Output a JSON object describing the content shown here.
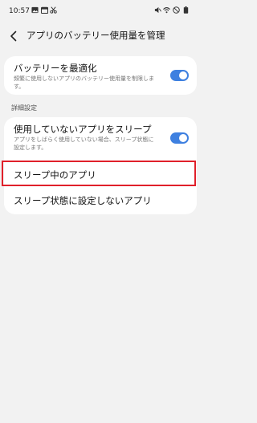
{
  "status_bar": {
    "time": "10:57",
    "left_icons": [
      "image-icon",
      "calendar-icon",
      "scissors-icon"
    ],
    "right_icons": [
      "mute-icon",
      "wifi-icon",
      "do-not-disturb-icon",
      "battery-icon"
    ]
  },
  "header": {
    "back_icon": "back-arrow-icon",
    "title": "アプリのバッテリー使用量を管理"
  },
  "optimize_card": {
    "title": "バッテリーを最適化",
    "description": "頻繁に使用しないアプリのバッテリー使用量を制限します。",
    "toggle_on": true
  },
  "section_header": "詳細設定",
  "advanced_card": {
    "sleep_unused": {
      "title": "使用していないアプリをスリープ",
      "description": "アプリをしばらく使用していない場合、スリープ状態に設定します。",
      "toggle_on": true
    },
    "sleeping_apps": {
      "title": "スリープ中のアプリ"
    },
    "never_sleeping_apps": {
      "title": "スリープ状態に設定しないアプリ"
    }
  },
  "colors": {
    "accent": "#3e80e0",
    "highlight": "#e0202a",
    "background": "#f2f2f2"
  }
}
